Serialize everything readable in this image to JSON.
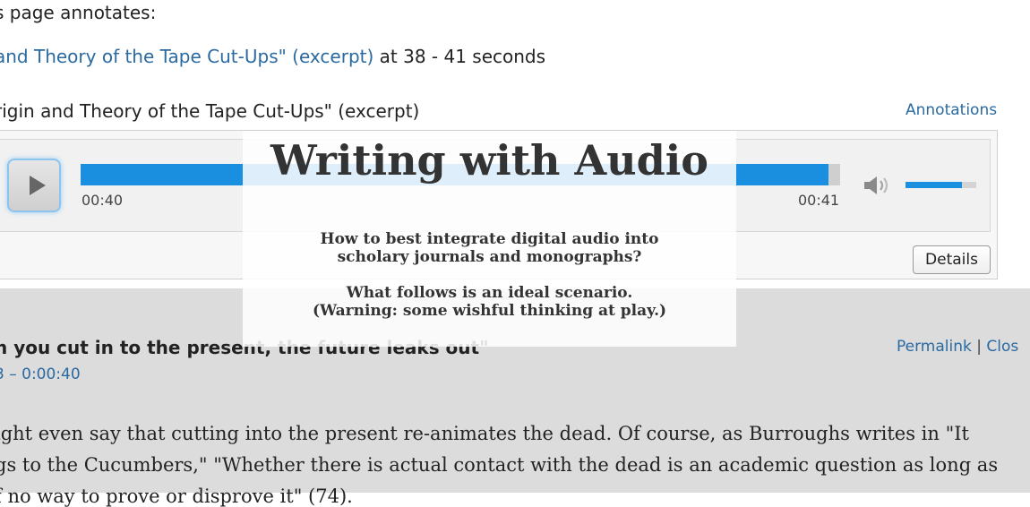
{
  "annotations_header": {
    "heading": "s page annotates:",
    "source_link": "and Theory of the Tape Cut-Ups\" (excerpt)",
    "range_text": " at 38 - 41 seconds"
  },
  "player": {
    "title": "rigin and Theory of the Tape Cut-Ups\" (excerpt)",
    "annotations_link": "Annotations",
    "current_time": "00:40",
    "total_time": "00:41",
    "progress_fraction": 0.985,
    "volume_fraction": 0.8,
    "details_label": "Details",
    "accent_color": "#1b8fdf",
    "play_icon": "play-icon",
    "speaker_icon": "speaker-icon"
  },
  "annotation": {
    "title": "n you cut in to the present, the future leaks out\"",
    "time_range": "3 – 0:00:40",
    "permalink_label": "Permalink",
    "separator": "|",
    "close_label": "Clos",
    "body_lines": [
      "ight even say that cutting into the present re-animates the dead. Of course, as Burroughs writes in \"It",
      "gs to the Cucumbers,\" \"Whether there is actual contact with the dead is an academic question as long as",
      "f no way to prove or disprove it\" (74)."
    ]
  },
  "overlay": {
    "title": "Writing with Audio",
    "paragraph1_line1": "How to best integrate digital audio into",
    "paragraph1_line2": "scholary journals and monographs?",
    "paragraph2_line1": "What follows is an ideal scenario.",
    "paragraph2_line2": "(Warning: some wishful thinking at play.)"
  }
}
